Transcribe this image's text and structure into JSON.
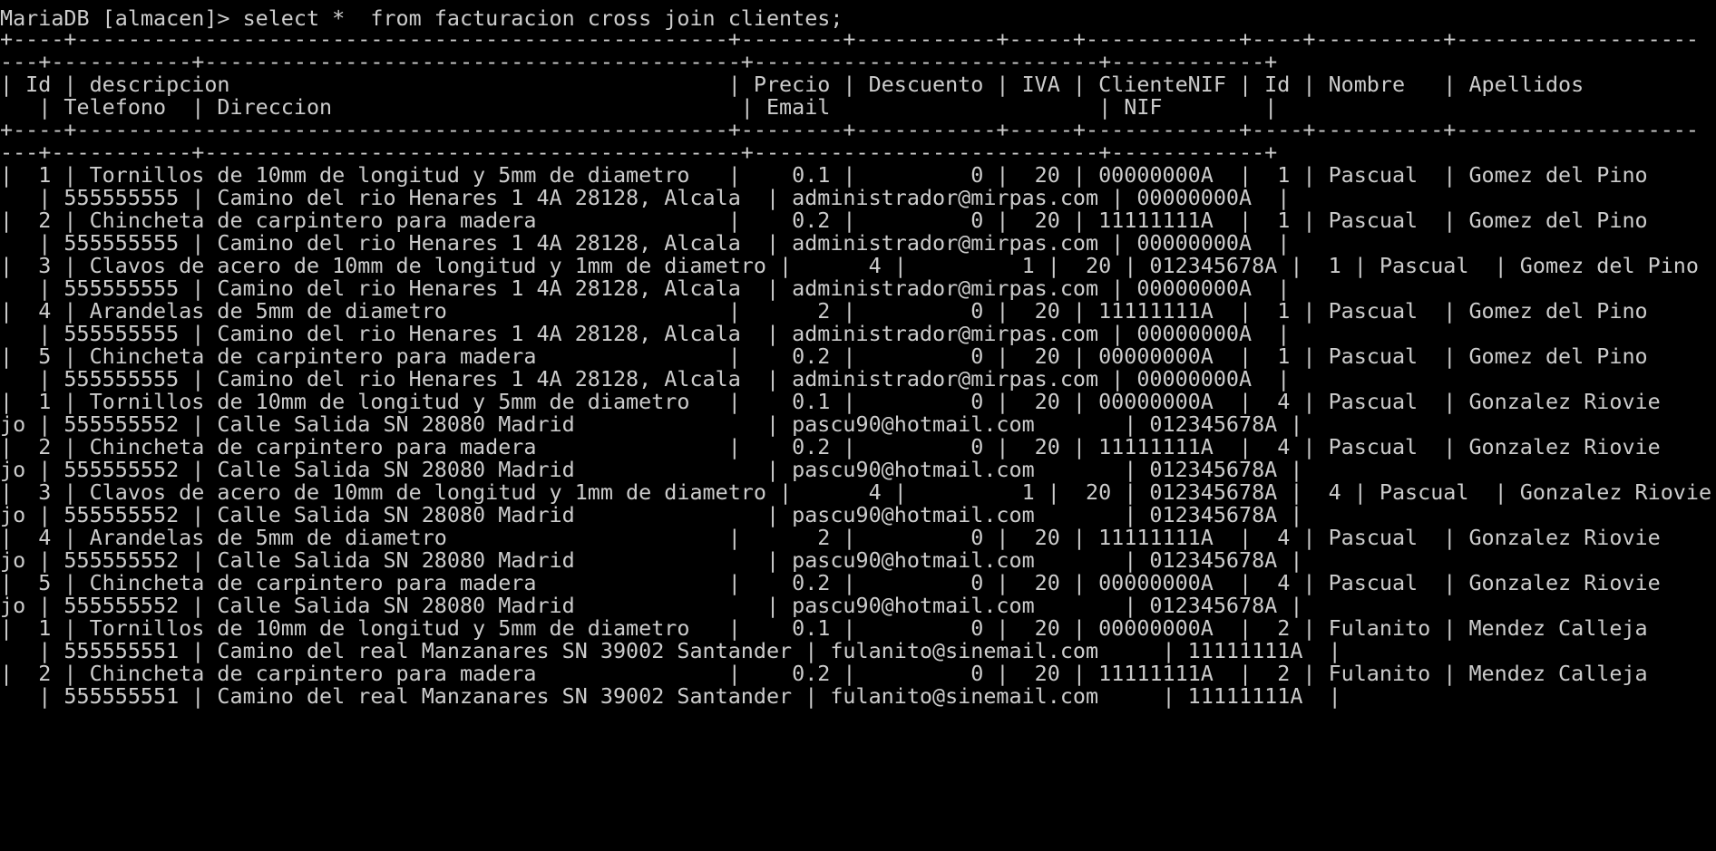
{
  "terminal": {
    "background_color": "#000000",
    "text_color": "#cccccc",
    "lines": [
      "MariaDB [almacen]> select *  from facturacion cross join clientes;",
      "+----+---------------------------------------------------+--------+-----------+-----+------------+----+----------+-------------------",
      "---+-----------+------------------------------------------+---------------------------+------------+",
      "| Id | descripcion                                       | Precio | Descuento | IVA | ClienteNIF | Id | Nombre   | Apellidos",
      "   | Telefono  | Direccion                                | Email                     | NIF        |",
      "+----+---------------------------------------------------+--------+-----------+-----+------------+----+----------+-------------------",
      "---+-----------+------------------------------------------+---------------------------+------------+",
      "|  1 | Tornillos de 10mm de longitud y 5mm de diametro   |    0.1 |         0 |  20 | 00000000A  |  1 | Pascual  | Gomez del Pino",
      "   | 555555555 | Camino del rio Henares 1 4A 28128, Alcala  | administrador@mirpas.com | 00000000A  |",
      "|  2 | Chincheta de carpintero para madera               |    0.2 |         0 |  20 | 11111111A  |  1 | Pascual  | Gomez del Pino",
      "   | 555555555 | Camino del rio Henares 1 4A 28128, Alcala  | administrador@mirpas.com | 00000000A  |",
      "|  3 | Clavos de acero de 10mm de longitud y 1mm de diametro |      4 |         1 |  20 | 012345678A |  1 | Pascual  | Gomez del Pino",
      "   | 555555555 | Camino del rio Henares 1 4A 28128, Alcala  | administrador@mirpas.com | 00000000A  |",
      "|  4 | Arandelas de 5mm de diametro                      |      2 |         0 |  20 | 11111111A  |  1 | Pascual  | Gomez del Pino",
      "   | 555555555 | Camino del rio Henares 1 4A 28128, Alcala  | administrador@mirpas.com | 00000000A  |",
      "|  5 | Chincheta de carpintero para madera               |    0.2 |         0 |  20 | 00000000A  |  1 | Pascual  | Gomez del Pino",
      "   | 555555555 | Camino del rio Henares 1 4A 28128, Alcala  | administrador@mirpas.com | 00000000A  |",
      "|  1 | Tornillos de 10mm de longitud y 5mm de diametro   |    0.1 |         0 |  20 | 00000000A  |  4 | Pascual  | Gonzalez Riovie",
      "jo | 555555552 | Calle Salida SN 28080 Madrid               | pascu90@hotmail.com       | 012345678A |",
      "|  2 | Chincheta de carpintero para madera               |    0.2 |         0 |  20 | 11111111A  |  4 | Pascual  | Gonzalez Riovie",
      "jo | 555555552 | Calle Salida SN 28080 Madrid               | pascu90@hotmail.com       | 012345678A |",
      "|  3 | Clavos de acero de 10mm de longitud y 1mm de diametro |      4 |         1 |  20 | 012345678A |  4 | Pascual  | Gonzalez Riovie",
      "jo | 555555552 | Calle Salida SN 28080 Madrid               | pascu90@hotmail.com       | 012345678A |",
      "|  4 | Arandelas de 5mm de diametro                      |      2 |         0 |  20 | 11111111A  |  4 | Pascual  | Gonzalez Riovie",
      "jo | 555555552 | Calle Salida SN 28080 Madrid               | pascu90@hotmail.com       | 012345678A |",
      "|  5 | Chincheta de carpintero para madera               |    0.2 |         0 |  20 | 00000000A  |  4 | Pascual  | Gonzalez Riovie",
      "jo | 555555552 | Calle Salida SN 28080 Madrid               | pascu90@hotmail.com       | 012345678A |",
      "|  1 | Tornillos de 10mm de longitud y 5mm de diametro   |    0.1 |         0 |  20 | 00000000A  |  2 | Fulanito | Mendez Calleja",
      "   | 555555551 | Camino del real Manzanares SN 39002 Santander | fulanito@sinemail.com     | 11111111A  |",
      "|  2 | Chincheta de carpintero para madera               |    0.2 |         0 |  20 | 11111111A  |  2 | Fulanito | Mendez Calleja",
      "   | 555555551 | Camino del real Manzanares SN 39002 Santander | fulanito@sinemail.com     | 11111111A  |"
    ]
  }
}
